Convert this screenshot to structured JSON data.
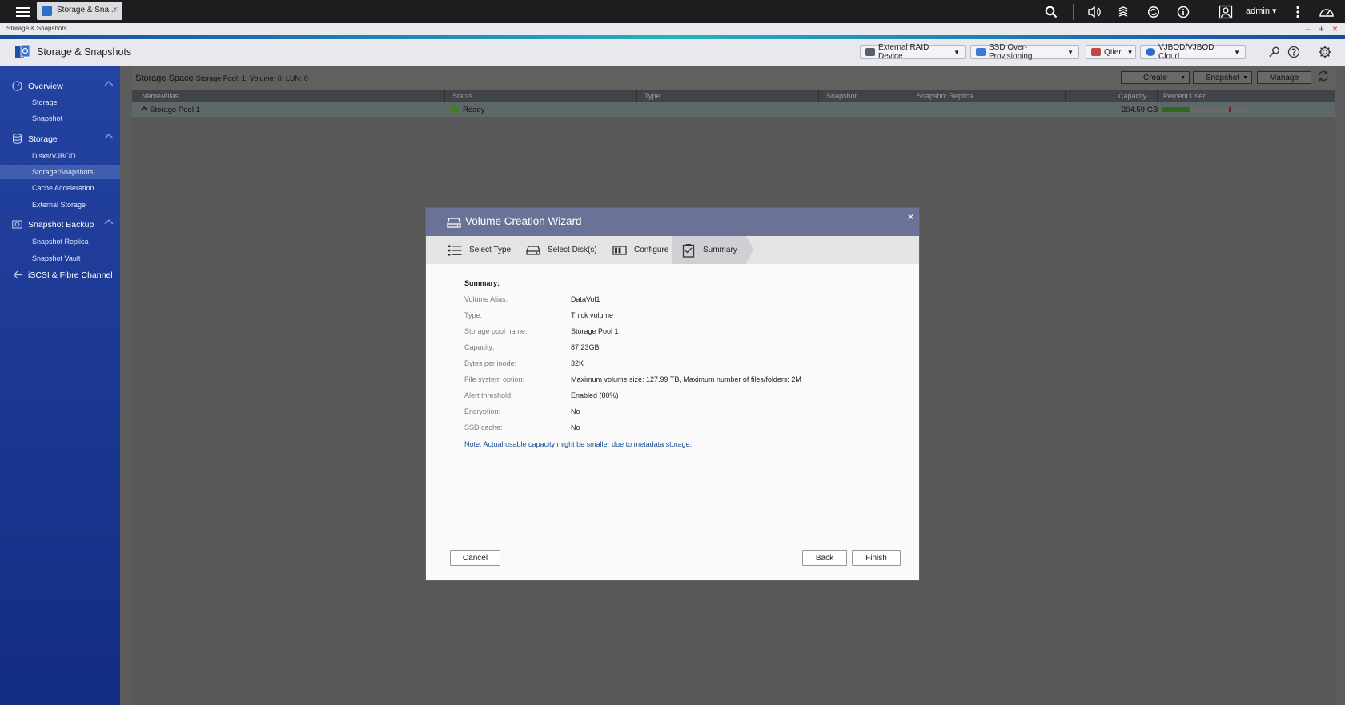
{
  "topbar": {
    "tab_label": "Storage & Sna...",
    "tab_close": "×",
    "user": "admin ▾"
  },
  "window": {
    "title": "Storage & Snapshots",
    "minimize": "–",
    "maximize": "+",
    "close": "×"
  },
  "header": {
    "title": "Storage & Snapshots",
    "buttons": [
      {
        "label": "External RAID Device",
        "icon_color": "#5a5f6d"
      },
      {
        "label": "SSD Over-Provisioning",
        "icon_color": "#3b7ad6"
      },
      {
        "label": "Qtier",
        "icon_color": "#c04848"
      },
      {
        "label": "VJBOD/VJBOD Cloud",
        "icon_color": "#2f6ac6"
      }
    ]
  },
  "sidebar": {
    "groups": [
      {
        "label": "Overview",
        "items": [
          "Storage",
          "Snapshot"
        ]
      },
      {
        "label": "Storage",
        "items": [
          "Disks/VJBOD",
          "Storage/Snapshots",
          "Cache Acceleration",
          "External Storage"
        ]
      },
      {
        "label": "Snapshot Backup",
        "items": [
          "Snapshot Replica",
          "Snapshot Vault"
        ]
      },
      {
        "label": "iSCSI & Fibre Channel",
        "items": []
      }
    ],
    "active_item": "Storage/Snapshots"
  },
  "main": {
    "title": "Storage Space",
    "info": "Storage Pool: 1, Volume: 0, LUN: 0",
    "actions": {
      "create": "Create",
      "snapshot": "Snapshot",
      "manage": "Manage"
    },
    "columns": [
      "Name/Alias",
      "Status",
      "Type",
      "Snapshot",
      "Snapshot Replica",
      "Capacity",
      "Percent Used"
    ],
    "pool": {
      "name": "Storage Pool 1",
      "status": "Ready",
      "capacity": "204.59 GB",
      "used_fraction": 0.34,
      "threshold_fraction": 0.8
    }
  },
  "wizard": {
    "title": "Volume Creation Wizard",
    "close": "×",
    "steps": [
      "Select Type",
      "Select Disk(s)",
      "Configure",
      "Summary"
    ],
    "active_step": 3,
    "summary_title": "Summary:",
    "summary": [
      {
        "k": "Volume Alias:",
        "v": "DataVol1"
      },
      {
        "k": "Type:",
        "v": "Thick volume"
      },
      {
        "k": "Storage pool name:",
        "v": "Storage Pool 1"
      },
      {
        "k": "Capacity:",
        "v": "87.23GB"
      },
      {
        "k": "Bytes per inode:",
        "v": "32K"
      },
      {
        "k": "File system option:",
        "v": "Maximum volume size: 127.99 TB, Maximum number of files/folders: 2M"
      },
      {
        "k": "Alert threshold:",
        "v": "Enabled (80%)"
      },
      {
        "k": "Encryption:",
        "v": "No"
      },
      {
        "k": "SSD cache:",
        "v": "No"
      }
    ],
    "note": "Note: Actual usable capacity might be smaller due to metadata storage.",
    "buttons": {
      "cancel": "Cancel",
      "back": "Back",
      "finish": "Finish"
    }
  }
}
